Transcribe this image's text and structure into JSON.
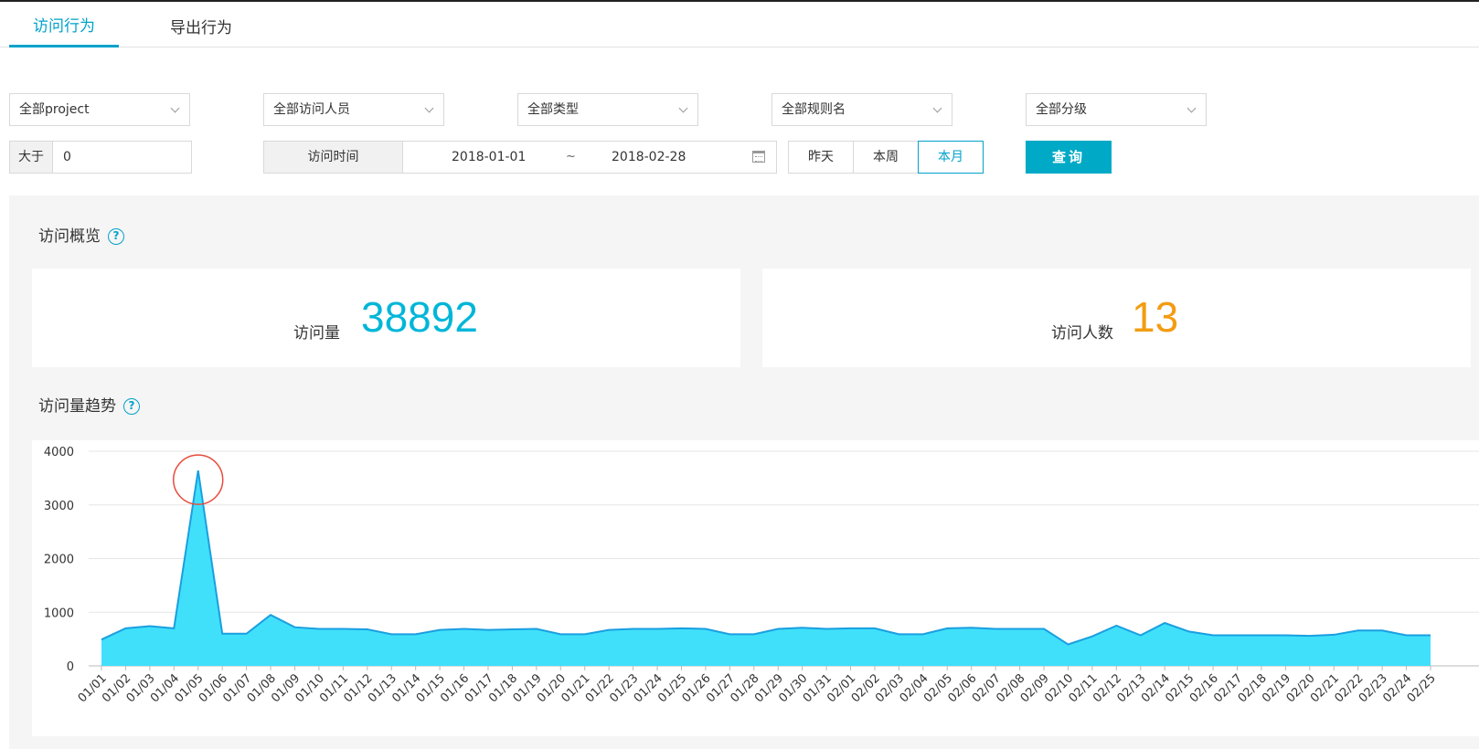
{
  "tabs": [
    {
      "label": "访问行为",
      "active": true
    },
    {
      "label": "导出行为",
      "active": false
    }
  ],
  "filters": {
    "project": "全部project",
    "visitor": "全部访问人员",
    "type": "全部类型",
    "rule_name": "全部规则名",
    "level": "全部分级"
  },
  "threshold": {
    "label": "大于",
    "value": "0"
  },
  "time_range": {
    "label": "访问时间",
    "start": "2018-01-01",
    "separator": "~",
    "end": "2018-02-28"
  },
  "quick_ranges": [
    {
      "label": "昨天",
      "active": false
    },
    {
      "label": "本周",
      "active": false
    },
    {
      "label": "本月",
      "active": true
    }
  ],
  "query_label": "查询",
  "overview": {
    "title": "访问概览",
    "help": "?",
    "visits_label": "访问量",
    "visits_value": "38892",
    "visitors_label": "访问人数",
    "visitors_value": "13"
  },
  "trend": {
    "title": "访问量趋势",
    "help": "?"
  },
  "colors": {
    "accent": "#00a2ca",
    "chart_fill": "#40e0fb",
    "chart_line": "#1a9fe0",
    "highlight_circle": "#e74c3c",
    "visitors_value": "#f39c12"
  },
  "chart_data": {
    "type": "area",
    "title": "",
    "xlabel": "",
    "ylabel": "",
    "ylim": [
      0,
      4000
    ],
    "yticks": [
      0,
      1000,
      2000,
      3000,
      4000
    ],
    "grid": true,
    "highlight_index": 4,
    "x": [
      "01/01",
      "01/02",
      "01/03",
      "01/04",
      "01/05",
      "01/06",
      "01/07",
      "01/08",
      "01/09",
      "01/10",
      "01/11",
      "01/12",
      "01/13",
      "01/14",
      "01/15",
      "01/16",
      "01/17",
      "01/18",
      "01/19",
      "01/20",
      "01/21",
      "01/22",
      "01/23",
      "01/24",
      "01/25",
      "01/26",
      "01/27",
      "01/28",
      "01/29",
      "01/30",
      "01/31",
      "02/01",
      "02/02",
      "02/03",
      "02/04",
      "02/05",
      "02/06",
      "02/07",
      "02/08",
      "02/09",
      "02/10",
      "02/11",
      "02/12",
      "02/13",
      "02/14",
      "02/15",
      "02/16",
      "02/17",
      "02/18",
      "02/19",
      "02/20",
      "02/21",
      "02/22",
      "02/23",
      "02/24",
      "02/25"
    ],
    "values": [
      490,
      700,
      740,
      700,
      3640,
      600,
      600,
      950,
      720,
      690,
      690,
      680,
      590,
      590,
      670,
      690,
      670,
      680,
      690,
      590,
      590,
      670,
      690,
      690,
      700,
      690,
      590,
      590,
      690,
      710,
      690,
      700,
      700,
      590,
      590,
      700,
      710,
      690,
      690,
      690,
      400,
      550,
      750,
      570,
      800,
      640,
      570,
      570,
      570,
      570,
      560,
      580,
      660,
      660,
      570,
      570
    ]
  }
}
